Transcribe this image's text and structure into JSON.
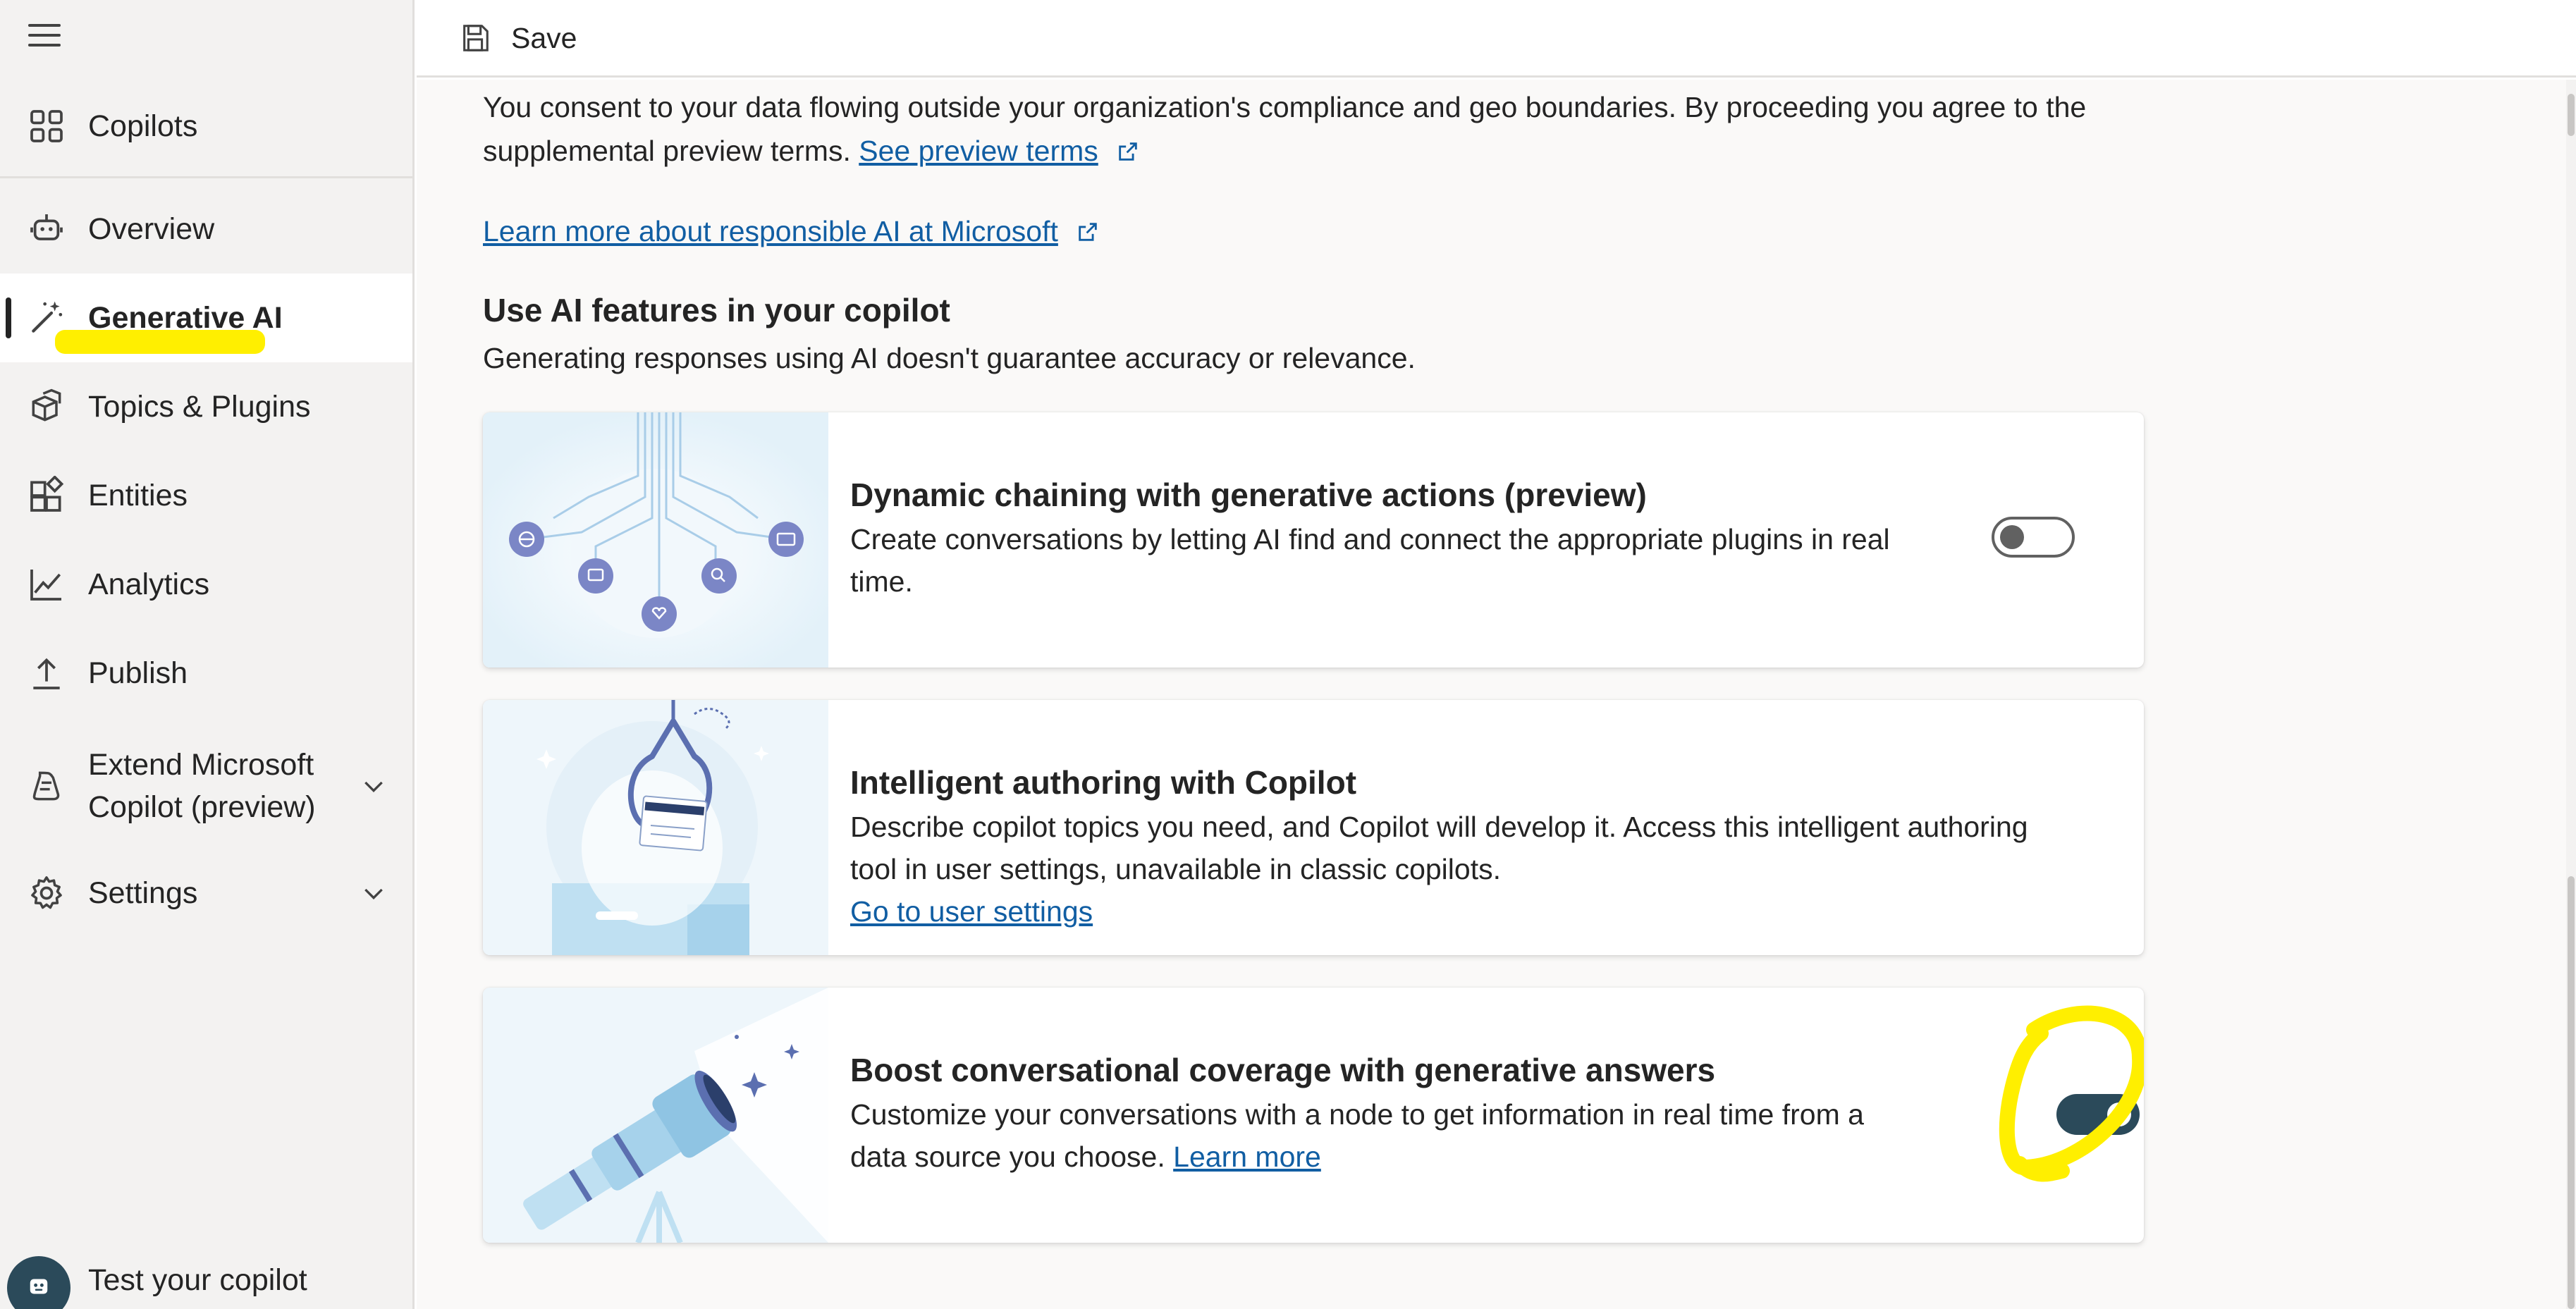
{
  "sidebar": {
    "items": [
      {
        "label": "Copilots",
        "icon": "grid-icon"
      },
      {
        "label": "Overview",
        "icon": "bot-icon"
      },
      {
        "label": "Generative AI",
        "icon": "magic-wand-icon"
      },
      {
        "label": "Topics & Plugins",
        "icon": "cubes-icon"
      },
      {
        "label": "Entities",
        "icon": "shapes-icon"
      },
      {
        "label": "Analytics",
        "icon": "chart-line-icon"
      },
      {
        "label": "Publish",
        "icon": "upload-icon"
      },
      {
        "label_line1": "Extend Microsoft",
        "label_line2": "Copilot (preview)",
        "icon": "copilot-icon"
      },
      {
        "label": "Settings",
        "icon": "gear-icon"
      }
    ],
    "test_label": "Test your copilot"
  },
  "toolbar": {
    "save_label": "Save"
  },
  "main": {
    "consent_line1": "You consent to your data flowing outside your organization's compliance and geo boundaries. By proceeding you agree to the",
    "consent_line2": "supplemental preview terms.",
    "preview_link": "See preview terms",
    "responsible_ai_link": "Learn more about responsible AI at Microsoft",
    "section_title": "Use AI features in your copilot",
    "section_subtitle": "Generating responses using AI doesn't guarantee accuracy or relevance.",
    "cards": [
      {
        "title": "Dynamic chaining with generative actions (preview)",
        "desc_line1": "Create conversations by letting AI find and connect the appropriate plugins in real",
        "desc_line2": "time.",
        "toggle_on": false
      },
      {
        "title": "Intelligent authoring with Copilot",
        "desc_line1": "Describe copilot topics you need, and Copilot will develop it. Access this intelligent authoring",
        "desc_line2": "tool in user settings, unavailable in classic copilots.",
        "link": "Go to user settings"
      },
      {
        "title": "Boost conversational coverage with generative answers",
        "desc_line1": "Customize your conversations with a node to get information in real time from a",
        "desc_line2": "data source you choose.",
        "link": "Learn more",
        "toggle_on": true
      }
    ]
  },
  "colors": {
    "accent": "#2b4a5a",
    "link": "#115ea3",
    "highlight": "#ffef00",
    "sidebar_bg": "#f3f2f1"
  }
}
